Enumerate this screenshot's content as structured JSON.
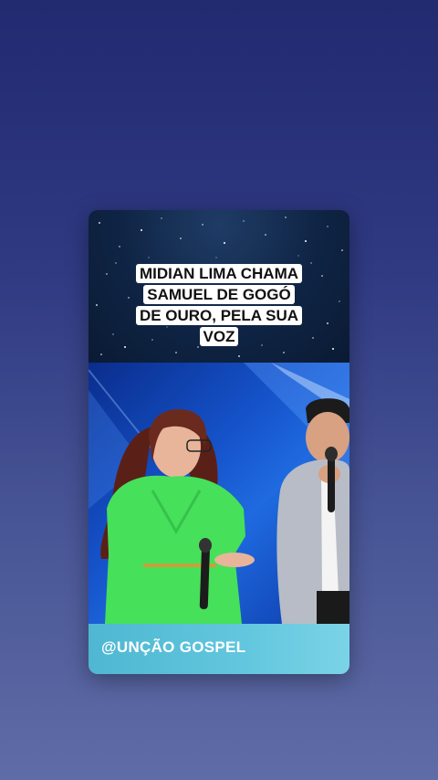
{
  "caption": {
    "lines": [
      "MIDIAN LIMA CHAMA",
      "SAMUEL DE GOGÓ",
      "DE OURO, PELA SUA",
      "VOZ"
    ]
  },
  "watermark": "@UNÇÃO GOSPEL",
  "colors": {
    "background_top": "#222a70",
    "background_bottom": "#5f6ca6",
    "caption_bg": "#ffffff",
    "footer_band": "#62c7de",
    "stage_blue": "#1552c9"
  }
}
